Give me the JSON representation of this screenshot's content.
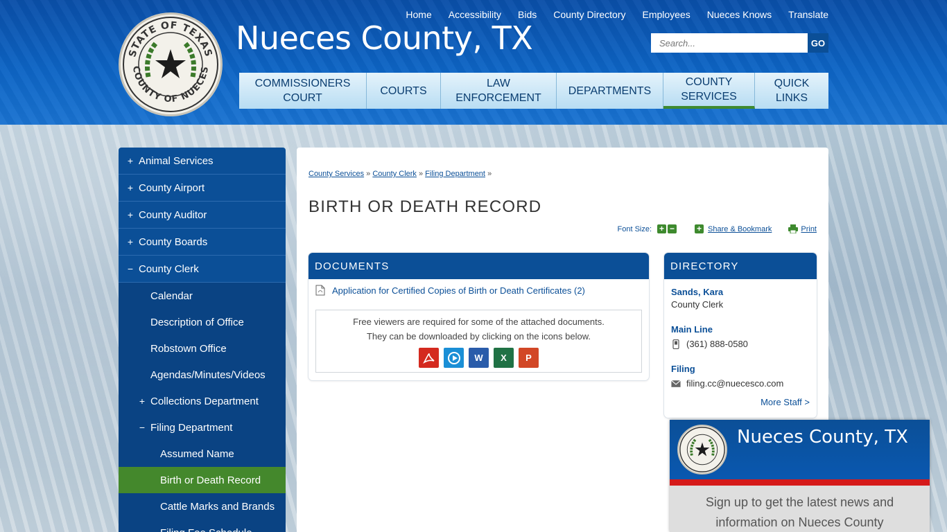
{
  "header": {
    "title": "Nueces County, TX",
    "utility_links": [
      "Home",
      "Accessibility",
      "Bids",
      "County Directory",
      "Employees",
      "Nueces Knows",
      "Translate"
    ],
    "search_placeholder": "Search...",
    "search_button": "GO",
    "seal": {
      "top_text": "STATE OF TEXAS",
      "bottom_text": "COUNTY OF NUECES"
    }
  },
  "main_nav": [
    {
      "label": "COMMISSIONERS COURT",
      "line1": "COMMISSIONERS",
      "line2": "COURT"
    },
    {
      "label": "COURTS",
      "line1": "COURTS",
      "line2": ""
    },
    {
      "label": "LAW ENFORCEMENT",
      "line1": "LAW",
      "line2": "ENFORCEMENT"
    },
    {
      "label": "DEPARTMENTS",
      "line1": "DEPARTMENTS",
      "line2": ""
    },
    {
      "label": "COUNTY SERVICES",
      "line1": "COUNTY",
      "line2": "SERVICES"
    },
    {
      "label": "QUICK LINKS",
      "line1": "QUICK",
      "line2": "LINKS"
    }
  ],
  "sidebar": {
    "top_items": [
      {
        "symbol": "+",
        "label": "Animal Services"
      },
      {
        "symbol": "+",
        "label": "County Airport"
      },
      {
        "symbol": "+",
        "label": "County Auditor"
      },
      {
        "symbol": "+",
        "label": "County Boards"
      },
      {
        "symbol": "−",
        "label": "County Clerk"
      }
    ],
    "clerk_items": [
      {
        "label": "Calendar"
      },
      {
        "label": "Description of Office"
      },
      {
        "label": "Robstown Office"
      },
      {
        "label": "Agendas/Minutes/Videos"
      }
    ],
    "collections": {
      "symbol": "+",
      "label": "Collections Department"
    },
    "filing": {
      "symbol": "−",
      "label": "Filing Department"
    },
    "filing_items": [
      {
        "label": "Assumed Name"
      },
      {
        "label": "Birth or Death Record"
      },
      {
        "label": "Cattle Marks and Brands"
      },
      {
        "label": "Filing Fee Schedule"
      }
    ]
  },
  "breadcrumb": {
    "items": [
      "County Services",
      "County Clerk",
      "Filing Department"
    ],
    "separator": "»"
  },
  "page_title": "BIRTH OR DEATH RECORD",
  "tools": {
    "font_size_label": "Font Size:",
    "share_label": "Share & Bookmark",
    "print_label": "Print"
  },
  "documents": {
    "heading": "DOCUMENTS",
    "link": "Application for Certified Copies of Birth or Death Certificates (2)",
    "viewer_line1": "Free viewers are required for some of the attached documents.",
    "viewer_line2": "They can be downloaded by clicking on the icons below.",
    "viewer_icons": [
      {
        "name": "pdf",
        "color": "#d42a1f"
      },
      {
        "name": "media",
        "color": "#1a8fd6"
      },
      {
        "name": "word",
        "color": "#2a5caa"
      },
      {
        "name": "excel",
        "color": "#207245"
      },
      {
        "name": "powerpoint",
        "color": "#d24726"
      }
    ]
  },
  "directory": {
    "heading": "DIRECTORY",
    "name": "Sands, Kara",
    "role": "County Clerk",
    "main_line_label": "Main Line",
    "phone": "(361) 888-0580",
    "filing_label": "Filing",
    "email": "filing.cc@nuecesco.com",
    "more": "More Staff >"
  },
  "signup": {
    "title": "Nueces County, TX",
    "line1": "Sign up to get the latest news and",
    "line2": "information on Nueces County"
  },
  "colors": {
    "primary": "#0b4f97",
    "accent_green": "#44882c",
    "signup_red": "#d51a1a"
  }
}
